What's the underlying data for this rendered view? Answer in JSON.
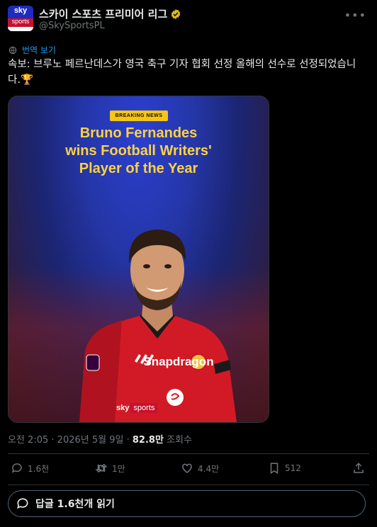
{
  "account": {
    "avatar_text_top": "sky",
    "avatar_text_bottom": "sports",
    "name": "스카이 스포츠 프리미어 리그",
    "handle": "@SkySportsPL"
  },
  "translate_label": "번역 보기",
  "tweet_text": "속보: 브루노 페르난데스가 영국 축구 기자 협회 선정 올해의 선수로 선정되었습니다.🏆",
  "media": {
    "badge": "BREAKING NEWS",
    "headline_lines": [
      "Bruno Fernandes",
      "wins Football Writers'",
      "Player of the Year"
    ],
    "brand_sky": "sky",
    "brand_sports": "sports",
    "shirt_sponsor": "Snapdragon"
  },
  "meta": {
    "time": "오전 2:05",
    "separator": "·",
    "date": "2026년 5월 9일",
    "views": "82.8만",
    "views_label": "조회수"
  },
  "actions": {
    "replies": "1.6천",
    "reposts": "1만",
    "likes": "4.4만",
    "bookmarks": "512"
  },
  "reply_prompt": "답글 1.6천개 읽기",
  "colors": {
    "background": "#000000",
    "text": "#e7e9ea",
    "muted": "#71767b",
    "link": "#1d9bf0",
    "verified": "#e2b719",
    "headline": "#ffd23f"
  }
}
